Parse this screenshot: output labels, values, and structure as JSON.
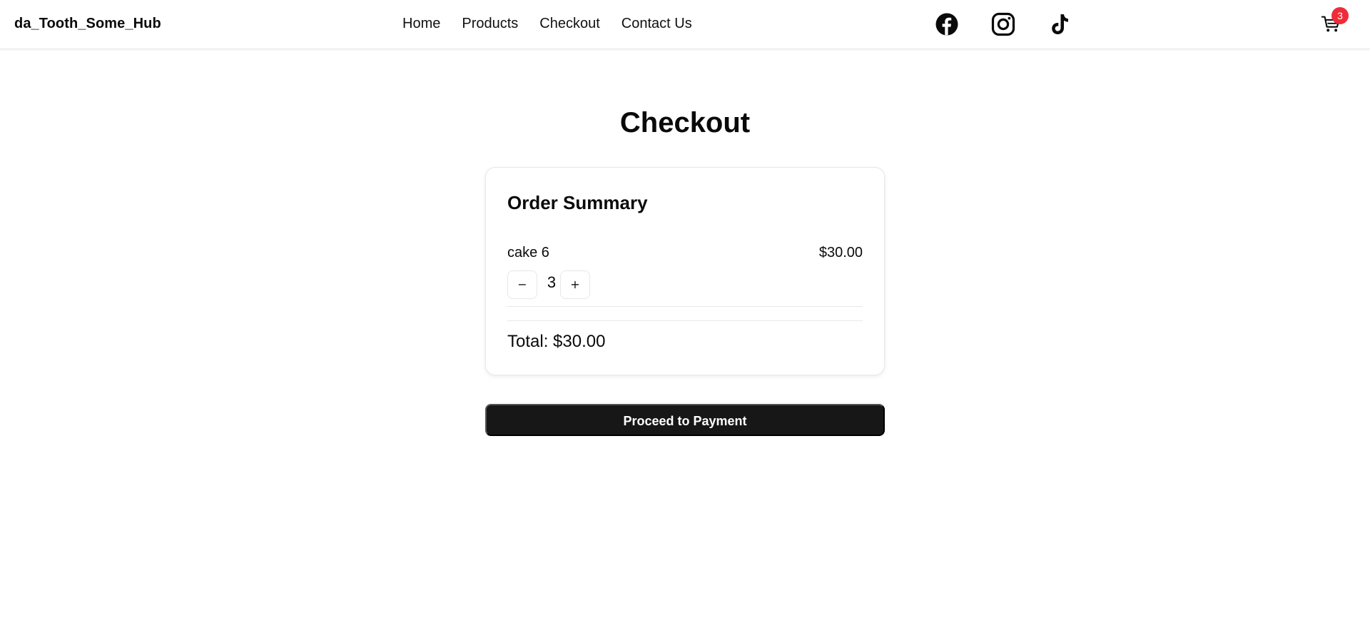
{
  "header": {
    "brand": "da_Tooth_Some_Hub",
    "nav": {
      "home": "Home",
      "products": "Products",
      "checkout": "Checkout",
      "contact": "Contact Us"
    },
    "social_icons": [
      "facebook-icon",
      "instagram-icon",
      "tiktok-icon"
    ],
    "cart": {
      "icon": "cart-icon",
      "count": "3",
      "badge_color": "#ef2b3a"
    }
  },
  "main": {
    "title": "Checkout",
    "order_summary": {
      "heading": "Order Summary",
      "items": [
        {
          "name": "cake 6",
          "price": "$30.00",
          "quantity": "3",
          "decrement_label": "−",
          "increment_label": "+"
        }
      ],
      "total": "Total: $30.00"
    },
    "pay_button": {
      "label": "Proceed to Payment",
      "background": "#171717"
    }
  }
}
